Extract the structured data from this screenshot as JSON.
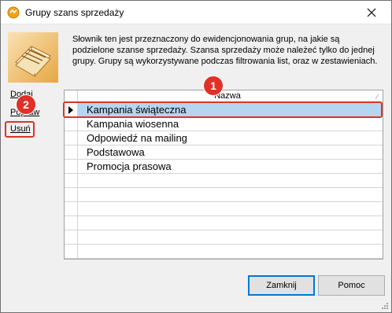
{
  "window": {
    "title": "Grupy szans sprzedaży"
  },
  "description": "Słownik ten jest przeznaczony do ewidencjonowania grup, na jakie są podzielone szanse sprzedaży. Szansa sprzedaży może należeć tylko do jednej grupy. Grupy są wykorzystywane podczas filtrowania list, oraz w zestawieniach.",
  "sidebar": {
    "add_label": "Dodaj",
    "edit_label": "Popraw",
    "delete_label": "Usuń"
  },
  "grid": {
    "column_header": "Nazwa",
    "rows": [
      "Kampania świąteczna",
      "Kampania wiosenna",
      "Odpowiedź na mailing",
      "Podstawowa",
      "Promocja prasowa",
      "",
      "",
      "",
      "",
      "",
      ""
    ],
    "selected_row": "Kampania świąteczna"
  },
  "buttons": {
    "close_label": "Zamknij",
    "help_label": "Pomoc"
  },
  "annotations": {
    "marker_1": "1",
    "marker_2": "2"
  },
  "colors": {
    "accent": "#0078d7",
    "selection": "#b5d6f1",
    "annotation": "#e03127"
  },
  "icons": {
    "title": "app-logo-icon",
    "close": "close-icon",
    "dictionary": "book-icon"
  }
}
